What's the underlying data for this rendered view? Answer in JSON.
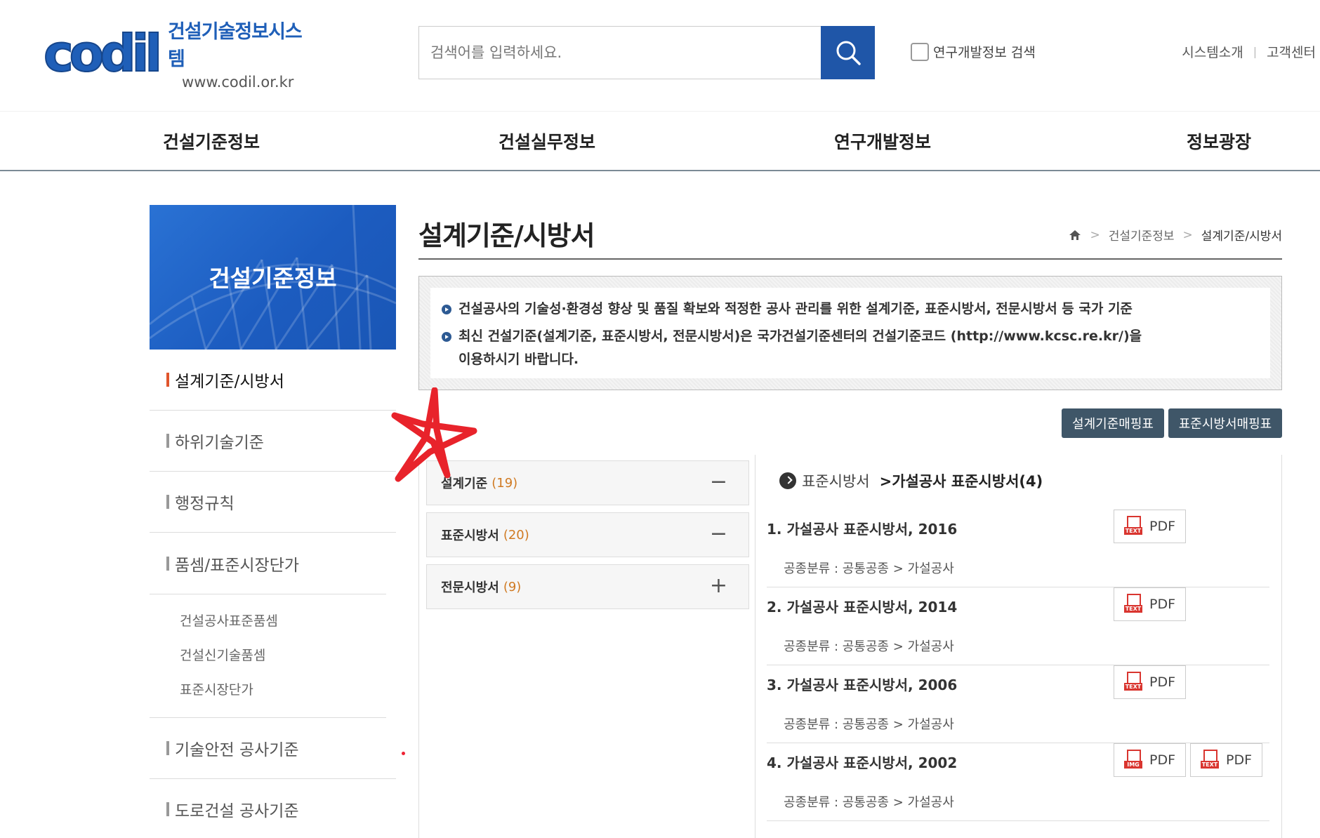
{
  "header": {
    "logo_mark": "codil",
    "logo_title": "건설기술정보시스템",
    "logo_url": "www.codil.or.kr",
    "search_placeholder": "검색어를 입력하세요.",
    "rd_search_label": "연구개발정보 검색",
    "top_links": [
      "시스템소개",
      "고객센터"
    ]
  },
  "gnb": [
    "건설기준정보",
    "건설실무정보",
    "연구개발정보",
    "정보광장"
  ],
  "sidebar": {
    "banner_title": "건설기준정보",
    "items": [
      {
        "label": "설계기준/시방서",
        "active": true
      },
      {
        "label": "하위기술기준"
      },
      {
        "label": "행정규칙"
      },
      {
        "label": "품셈/표준시장단가"
      }
    ],
    "sub_items": [
      "건설공사표준품셈",
      "건설신기술품셈",
      "표준시장단가"
    ],
    "items_after": [
      {
        "label": "기술안전 공사기준"
      },
      {
        "label": "도로건설 공사기준"
      }
    ]
  },
  "main": {
    "title": "설계기준/시방서",
    "breadcrumb": [
      "건설기준정보",
      "설계기준/시방서"
    ],
    "info": [
      "건설공사의 기술성·환경성 향상 및 품질 확보와 적정한 공사 관리를 위한 설계기준, 표준시방서, 전문시방서 등 국가 기준",
      "최신 건설기준(설계기준, 표준시방서, 전문시방서)은 국가건설기준센터의 건설기준코드 (http://www.kcsc.re.kr/)을",
      "이용하시기 바랍니다."
    ],
    "buttons": [
      "설계기준매핑표",
      "표준시방서매핑표"
    ],
    "categories": [
      {
        "label": "설계기준",
        "count": "(19)",
        "toggle": "−"
      },
      {
        "label": "표준시방서",
        "count": "(20)",
        "toggle": "−"
      },
      {
        "label": "전문시방서",
        "count": "(9)",
        "toggle": "+"
      }
    ],
    "list_path": "표준시방서",
    "list_current": ">가설공사 표준시방서(4)",
    "documents": [
      {
        "title": "1. 가설공사 표준시방서, 2016",
        "cls": "공종분류 : 공통공종 > 가설공사",
        "files": [
          {
            "tag": "TEXT",
            "label": "PDF"
          }
        ]
      },
      {
        "title": "2. 가설공사 표준시방서, 2014",
        "cls": "공종분류 : 공통공종 > 가설공사",
        "files": [
          {
            "tag": "TEXT",
            "label": "PDF"
          }
        ]
      },
      {
        "title": "3. 가설공사 표준시방서, 2006",
        "cls": "공종분류 : 공통공종 > 가설공사",
        "files": [
          {
            "tag": "TEXT",
            "label": "PDF"
          }
        ]
      },
      {
        "title": "4. 가설공사 표준시방서, 2002",
        "cls": "공종분류 : 공통공종 > 가설공사",
        "files": [
          {
            "tag": "IMG",
            "label": "PDF"
          },
          {
            "tag": "TEXT",
            "label": "PDF"
          }
        ]
      }
    ]
  },
  "colors": {
    "brand": "#1f56a8",
    "active_bar": "#e0552c",
    "count": "#d07a22",
    "annotation": "#e8232b"
  }
}
